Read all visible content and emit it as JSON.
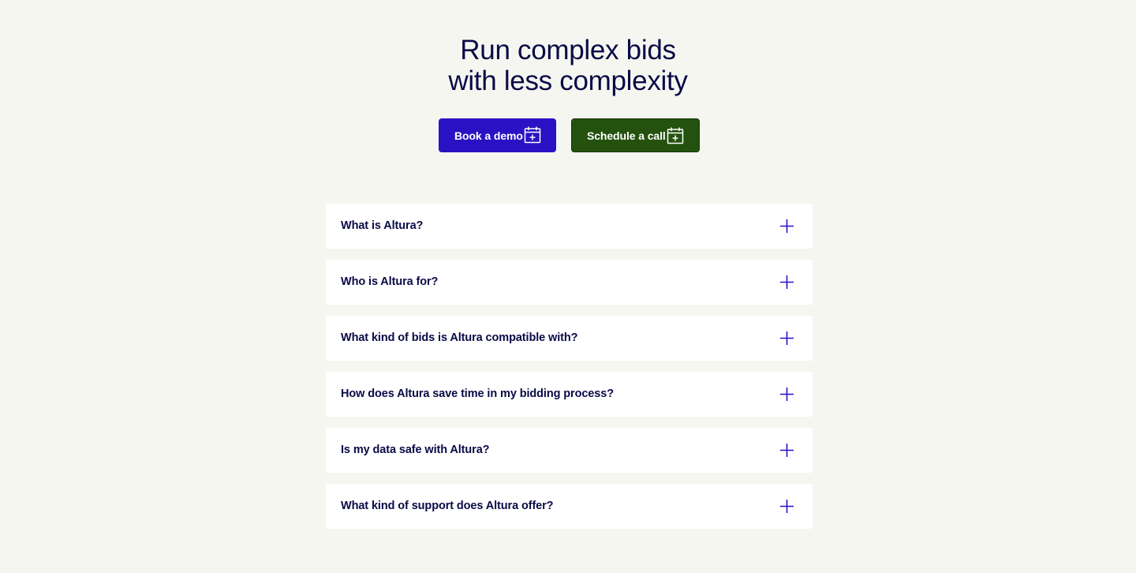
{
  "hero": {
    "title_line1": "Run complex bids",
    "title_line2": "with less complexity"
  },
  "buttons": {
    "demo_label": "Book a demo",
    "call_label": "Schedule a call"
  },
  "faq": {
    "items": [
      {
        "question": "What is Altura?"
      },
      {
        "question": "Who is Altura for?"
      },
      {
        "question": "What kind of bids is Altura compatible with?"
      },
      {
        "question": "How does Altura save time in my bidding process?"
      },
      {
        "question": "Is my data safe with Altura?"
      },
      {
        "question": "What kind of support does Altura offer?"
      }
    ]
  },
  "colors": {
    "background": "#f6f6f1",
    "heading_text": "#0a0a47",
    "demo_button": "#2a12c4",
    "call_button": "#24520e",
    "plus_icon": "#2a12c4"
  },
  "icons": {
    "button_icon": "calendar-plus-icon",
    "faq_icon": "plus-icon"
  }
}
